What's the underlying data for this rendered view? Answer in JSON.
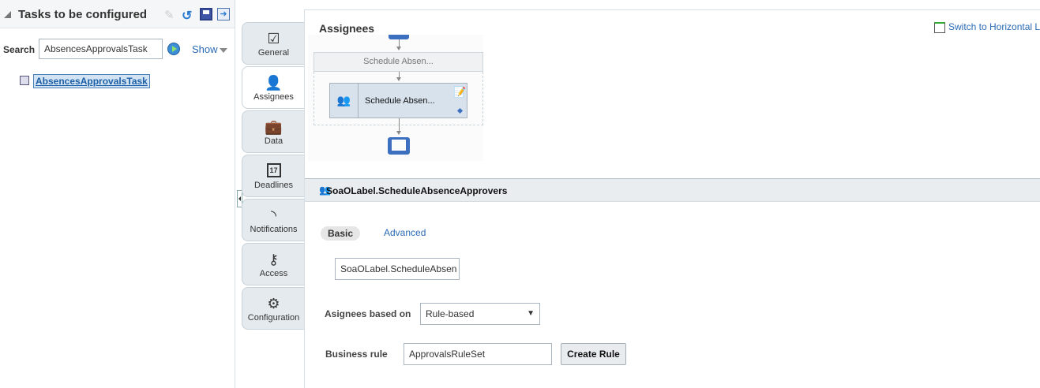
{
  "left_panel": {
    "title": "Tasks to be configured",
    "search_label": "Search",
    "search_value": "AbsencesApprovalsTask",
    "show_label": "Show",
    "tree_items": [
      "AbsencesApprovalsTask"
    ]
  },
  "tabs": [
    {
      "label": "General",
      "icon": "clipboard-check-icon"
    },
    {
      "label": "Assignees",
      "icon": "person-icon",
      "selected": true
    },
    {
      "label": "Data",
      "icon": "briefcase-icon"
    },
    {
      "label": "Deadlines",
      "icon": "calendar-icon"
    },
    {
      "label": "Notifications",
      "icon": "rss-icon"
    },
    {
      "label": "Access",
      "icon": "keys-icon"
    },
    {
      "label": "Configuration",
      "icon": "gear-icon"
    }
  ],
  "calendar_day": "17",
  "main": {
    "title": "Assignees",
    "switch_link": "Switch to Horizontal L",
    "stage_label": "Schedule Absen...",
    "node_label": "Schedule Absen...",
    "participant_title": "SoaOLabel.ScheduleAbsenceApprovers",
    "subtab_basic": "Basic",
    "subtab_advanced": "Advanced",
    "label_value": "SoaOLabel.ScheduleAbsen",
    "assignees_based_label": "Asignees based on",
    "assignees_based_value": "Rule-based",
    "business_rule_label": "Business rule",
    "business_rule_value": "ApprovalsRuleSet",
    "create_rule": "Create Rule"
  }
}
